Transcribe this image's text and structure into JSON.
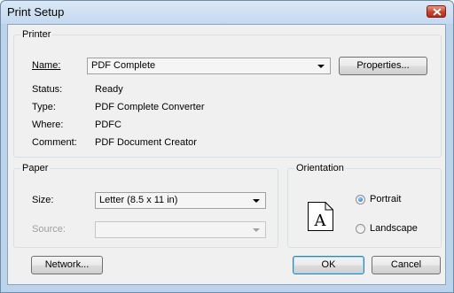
{
  "window": {
    "title": "Print Setup"
  },
  "printer": {
    "group_label": "Printer",
    "name_label": "Name:",
    "name_value": "PDF Complete",
    "properties_button": "Properties...",
    "status_label": "Status:",
    "status_value": "Ready",
    "type_label": "Type:",
    "type_value": "PDF Complete Converter",
    "where_label": "Where:",
    "where_value": "PDFC",
    "comment_label": "Comment:",
    "comment_value": "PDF Document Creator"
  },
  "paper": {
    "group_label": "Paper",
    "size_label": "Size:",
    "size_value": "Letter (8.5 x 11 in)",
    "source_label": "Source:",
    "source_value": ""
  },
  "orientation": {
    "group_label": "Orientation",
    "page_icon_letter": "A",
    "options": [
      {
        "label": "Portrait",
        "selected": true
      },
      {
        "label": "Landscape",
        "selected": false
      }
    ]
  },
  "buttons": {
    "network": "Network...",
    "ok": "OK",
    "cancel": "Cancel"
  },
  "colors": {
    "close_button": "#c9422b",
    "radio_selected": "#1f5db8"
  }
}
